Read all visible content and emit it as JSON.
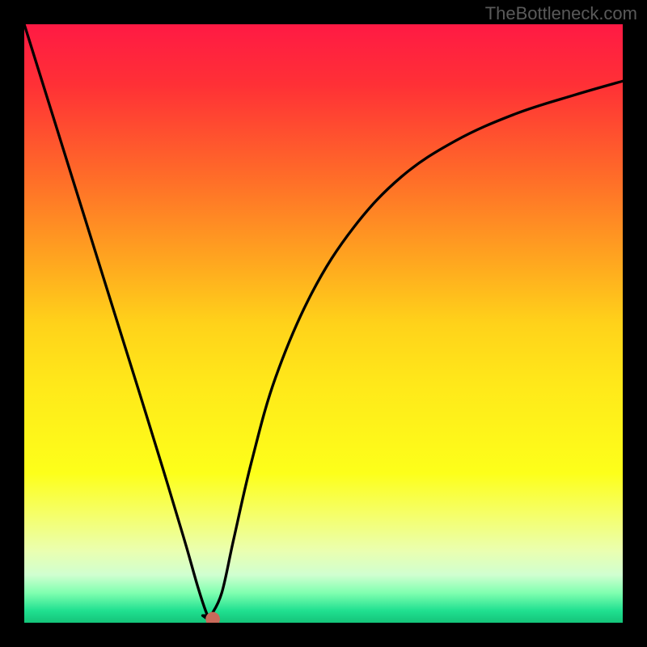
{
  "watermark": "TheBottleneck.com",
  "colors": {
    "background": "#000000",
    "curve": "#000000",
    "marker": "#c86a5a"
  },
  "chart_data": {
    "type": "line",
    "title": "",
    "xlabel": "",
    "ylabel": "",
    "xlim": [
      0,
      100
    ],
    "ylim": [
      0,
      100
    ],
    "grid": false,
    "legend": false,
    "gradient_stops": [
      {
        "offset": 0.0,
        "color": "#ff1a44"
      },
      {
        "offset": 0.1,
        "color": "#ff3036"
      },
      {
        "offset": 0.25,
        "color": "#ff6a29"
      },
      {
        "offset": 0.4,
        "color": "#ffa81f"
      },
      {
        "offset": 0.5,
        "color": "#ffd21a"
      },
      {
        "offset": 0.6,
        "color": "#ffe81a"
      },
      {
        "offset": 0.75,
        "color": "#fdff1a"
      },
      {
        "offset": 0.82,
        "color": "#f5ff6a"
      },
      {
        "offset": 0.88,
        "color": "#eaffb0"
      },
      {
        "offset": 0.92,
        "color": "#d0ffd0"
      },
      {
        "offset": 0.95,
        "color": "#80ffb0"
      },
      {
        "offset": 0.98,
        "color": "#20e090"
      },
      {
        "offset": 1.0,
        "color": "#14c47a"
      }
    ],
    "series": [
      {
        "name": "bottleneck-curve",
        "x": [
          0,
          5,
          10,
          15,
          20,
          24,
          27,
          29,
          30.5,
          31.5,
          33,
          35,
          38,
          42,
          48,
          55,
          63,
          72,
          82,
          92,
          100
        ],
        "y": [
          100,
          84,
          68,
          52,
          36,
          23,
          13,
          6,
          1.5,
          0,
          5,
          14,
          27,
          41,
          55,
          66,
          74.5,
          80.5,
          85,
          88.2,
          90.5
        ]
      }
    ],
    "marker": {
      "x": 31.5,
      "y": 0,
      "r": 1.2
    },
    "plateau": {
      "x1": 29.8,
      "x2": 31.2,
      "y": 1.2
    }
  }
}
